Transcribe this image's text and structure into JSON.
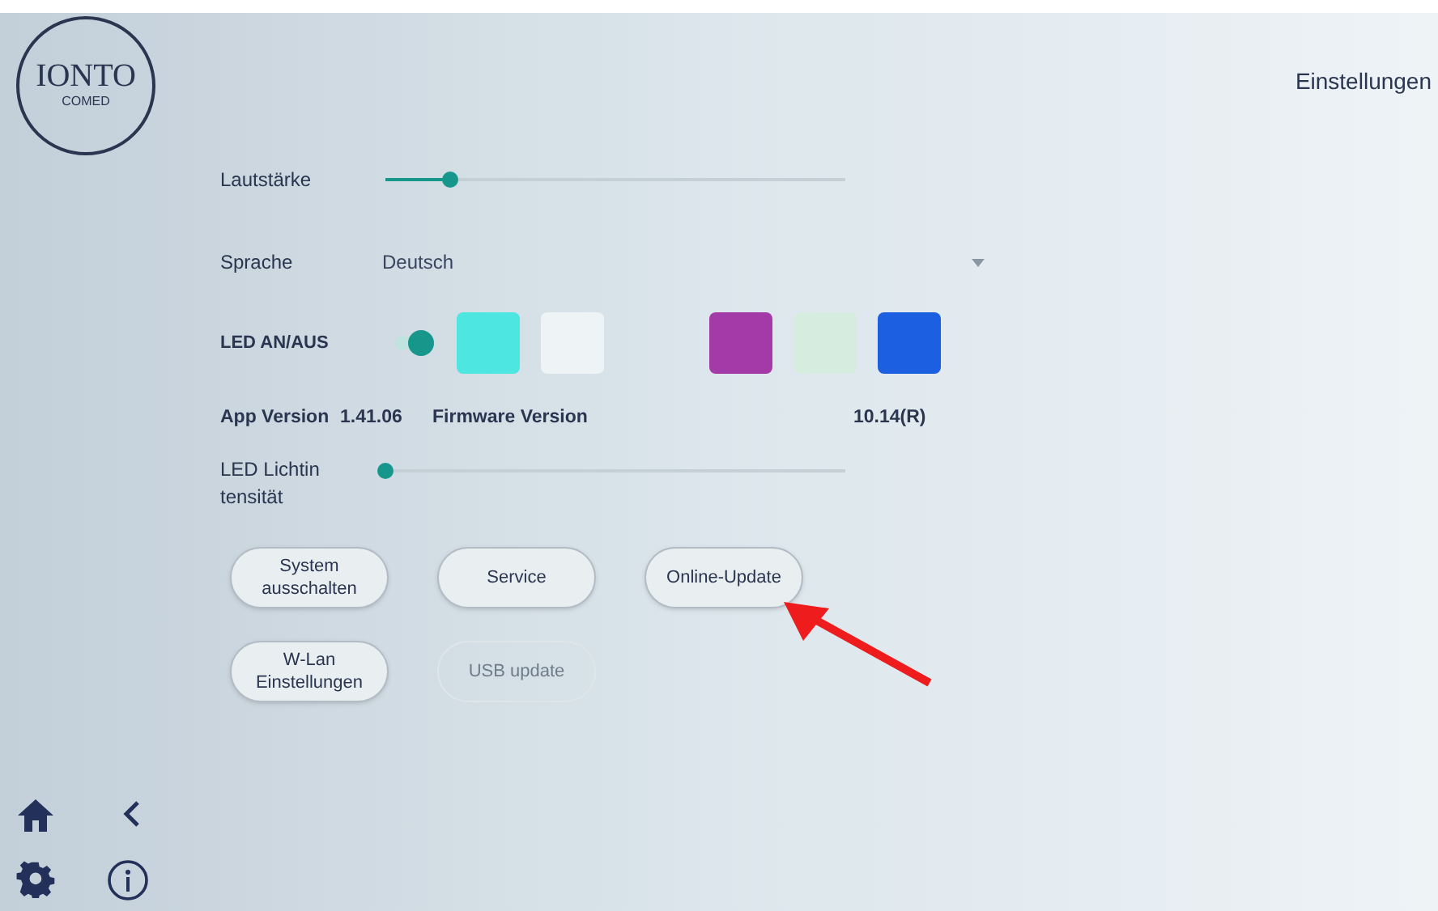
{
  "logo": {
    "name": "IONTO",
    "sub": "COMED"
  },
  "title": "Einstellungen",
  "volume": {
    "label": "Lautstärke",
    "level": 0.14
  },
  "language": {
    "label": "Sprache",
    "value": "Deutsch"
  },
  "led": {
    "label": "LED AN/AUS",
    "on": true,
    "swatches": [
      {
        "color": "#4ee6e0"
      },
      {
        "color": "#eef3f6"
      },
      {
        "color": "#a33aa8"
      },
      {
        "color": "#d6ecdf"
      },
      {
        "color": "#1c5fe0"
      }
    ]
  },
  "versions": {
    "app_label": "App Version",
    "app_value": "1.41.06",
    "firmware_label": "Firmware Version",
    "firmware_value": "10.14(R)"
  },
  "intensity": {
    "label": "LED Lichtintensität",
    "level": 0
  },
  "buttons": [
    {
      "label": "System ausschalten",
      "disabled": false
    },
    {
      "label": "Service",
      "disabled": false
    },
    {
      "label": "Online-Update",
      "disabled": false
    },
    {
      "label": "W-Lan Einstellungen",
      "disabled": false
    },
    {
      "label": "USB update",
      "disabled": true
    }
  ]
}
